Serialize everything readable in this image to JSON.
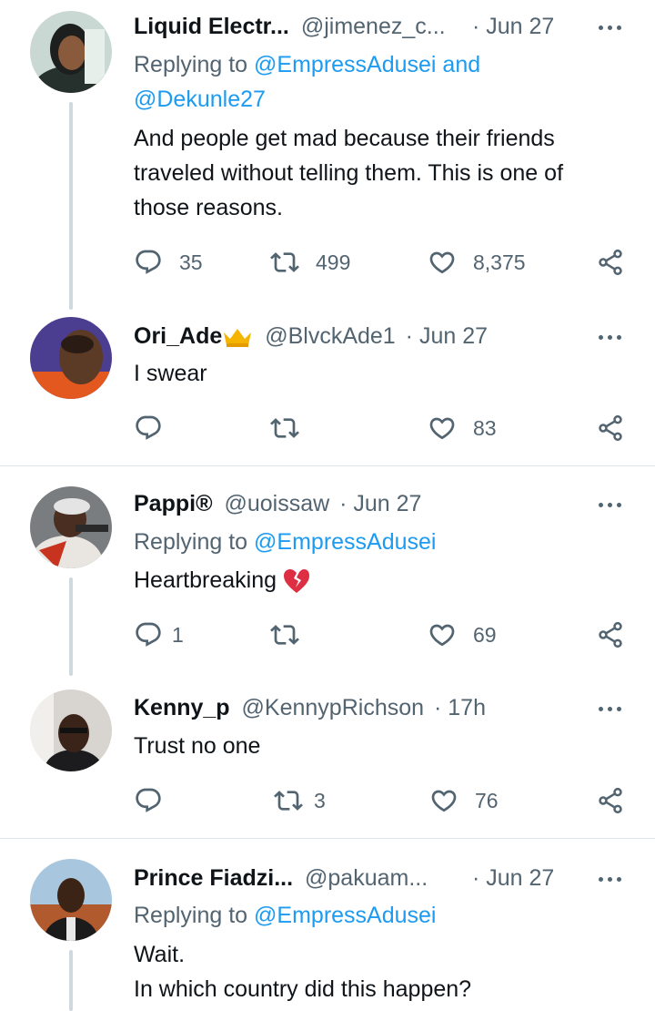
{
  "tweets": [
    {
      "name": "Liquid Electr...",
      "handle": "@jimenez_c...",
      "date": "· Jun 27",
      "replying_prefix": "Replying to ",
      "replying_to": "@EmpressAdusei and",
      "replying_to2": "@Dekunle27",
      "text": [
        "And people get mad because their friends",
        "traveled without telling them. This is one of",
        "those reasons."
      ],
      "replies": "35",
      "retweets": "499",
      "likes": "8,375"
    },
    {
      "name": "Ori_Ade",
      "name_emoji": "crown-icon",
      "handle": "@BlvckAde1",
      "date": "· Jun 27",
      "text": [
        "I swear"
      ],
      "replies": "",
      "retweets": "",
      "likes": "83"
    },
    {
      "name": "Pappi®",
      "handle": "@uoissaw",
      "date": "· Jun 27",
      "replying_prefix": "Replying to ",
      "replying_to": "@EmpressAdusei",
      "text": [
        "Heartbreaking"
      ],
      "text_emoji": "broken-heart-icon",
      "replies": "1",
      "retweets": "",
      "likes": "69"
    },
    {
      "name": "Kenny_p",
      "handle": "@KennypRichson",
      "date": "· 17h",
      "text": [
        "Trust no one"
      ],
      "replies": "",
      "retweets": "3",
      "likes": "76"
    },
    {
      "name": "Prince Fiadzi...",
      "handle": "@pakuam...",
      "date": "· Jun 27",
      "replying_prefix": "Replying to ",
      "replying_to": "@EmpressAdusei",
      "text": [
        "Wait.",
        "In which country did this happen?"
      ]
    }
  ],
  "colors": {
    "text": "#0f1419",
    "muted": "#536471",
    "link": "#1d9bf0",
    "thread_line": "#cfd9de",
    "divider": "#dfe4e8"
  }
}
